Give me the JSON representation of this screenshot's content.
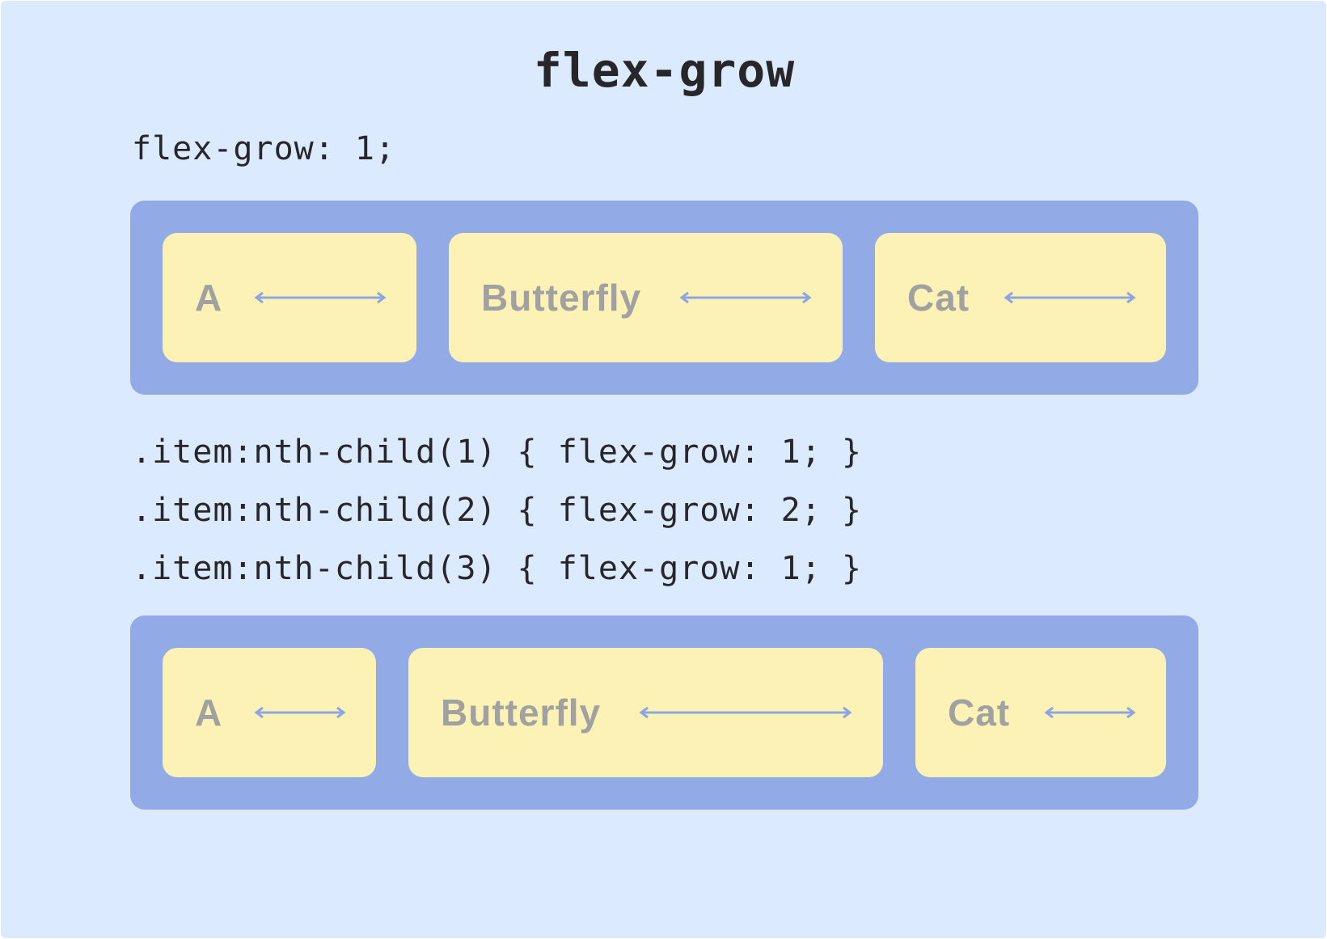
{
  "title": "flex-grow",
  "section1": {
    "code": "flex-grow: 1;",
    "items": [
      {
        "label": "A",
        "flex_grow": 1
      },
      {
        "label": "Butterfly",
        "flex_grow": 1
      },
      {
        "label": "Cat",
        "flex_grow": 1
      }
    ]
  },
  "section2": {
    "code_lines": [
      ".item:nth-child(1) { flex-grow: 1; }",
      ".item:nth-child(2) { flex-grow: 2; }",
      ".item:nth-child(3) { flex-grow: 1; }"
    ],
    "items": [
      {
        "label": "A",
        "flex_grow": 1
      },
      {
        "label": "Butterfly",
        "flex_grow": 2
      },
      {
        "label": "Cat",
        "flex_grow": 1
      }
    ]
  },
  "colors": {
    "background": "#dbeafe",
    "container": "#92aae6",
    "item": "#fcf2b6",
    "label": "#a1a1a1",
    "arrow": "#8ea5e4",
    "text": "#27272a"
  }
}
